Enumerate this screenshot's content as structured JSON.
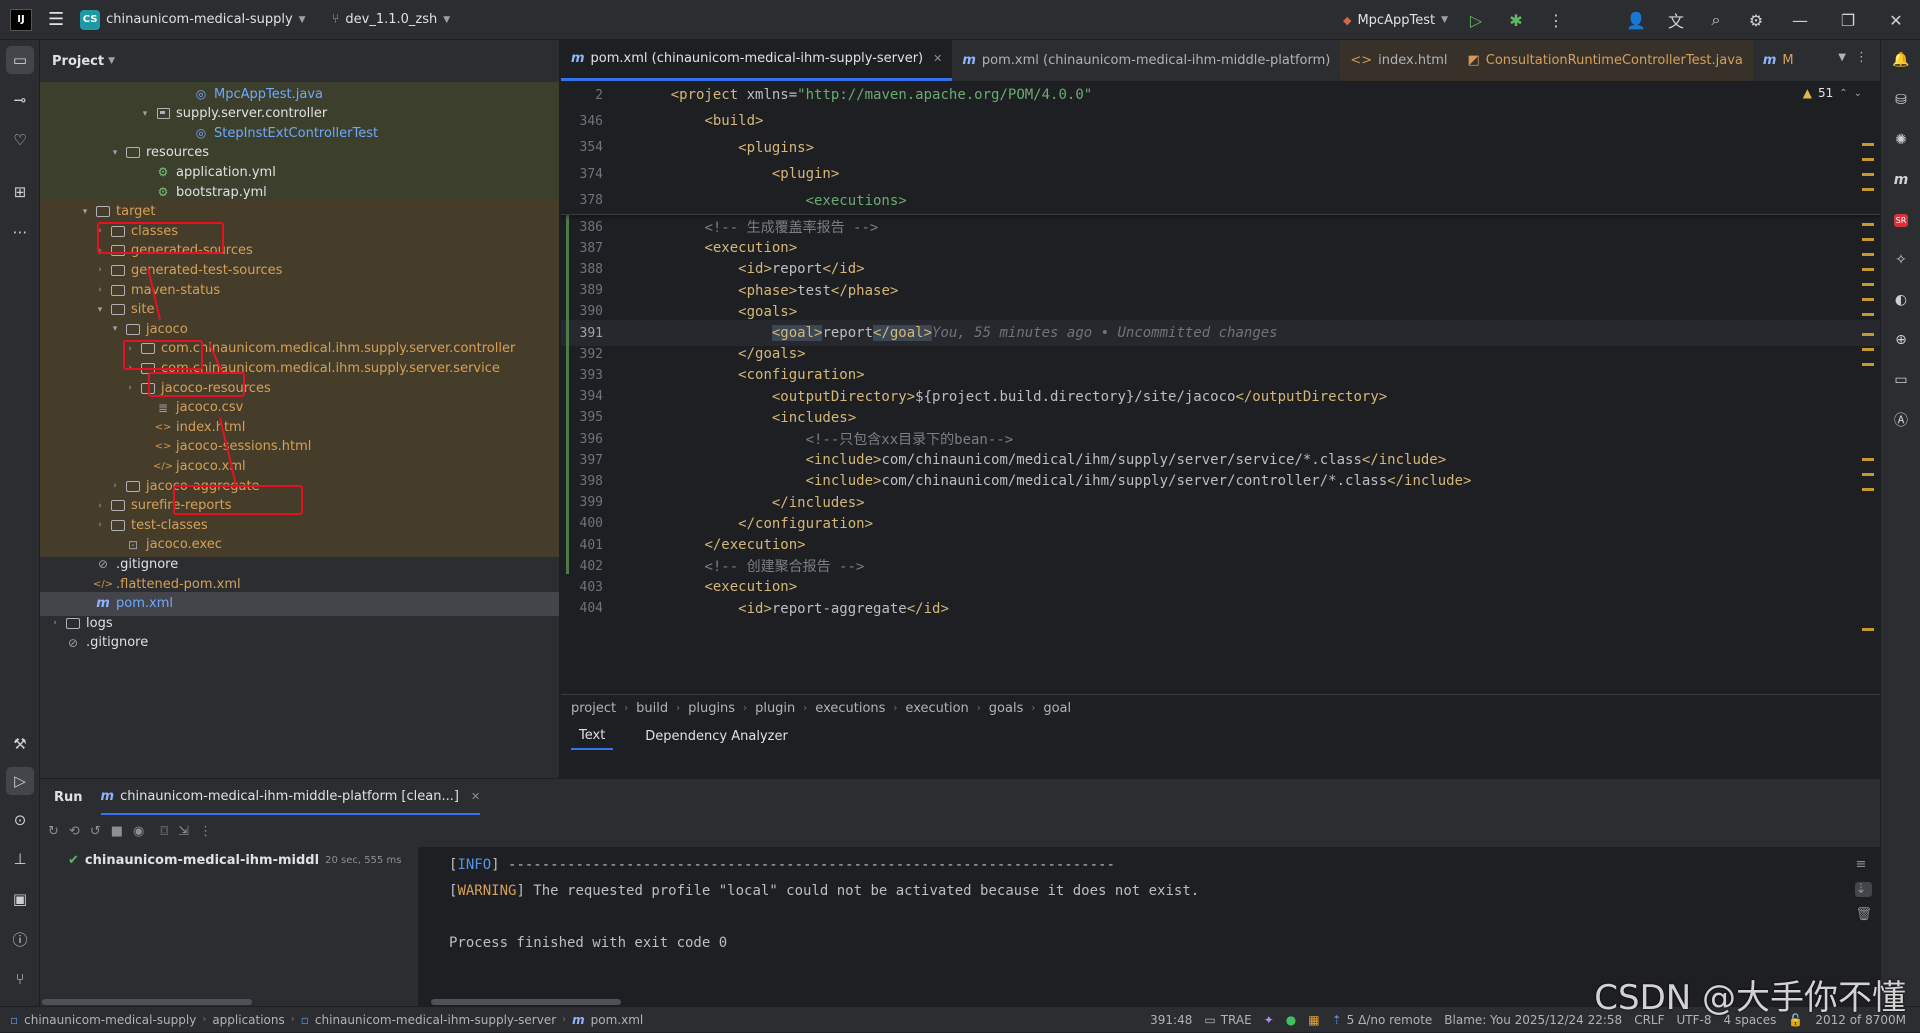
{
  "titlebar": {
    "app_logo": "IJ",
    "menu_icon": "hamburger-menu-icon",
    "project_badge": "CS",
    "project_name": "chinaunicom-medical-supply",
    "branch": "dev_1.1.0_zsh",
    "run_config": "MpcAppTest"
  },
  "project_panel": {
    "title": "Project",
    "rows": [
      {
        "label": "MpcAppTest.java",
        "type": "java"
      },
      {
        "label": "supply.server.controller",
        "type": "package"
      },
      {
        "label": "StepInstExtControllerTest",
        "type": "java"
      },
      {
        "label": "resources",
        "type": "folder"
      },
      {
        "label": "application.yml",
        "type": "yml"
      },
      {
        "label": "bootstrap.yml",
        "type": "yml"
      },
      {
        "label": "target",
        "type": "folder"
      },
      {
        "label": "classes",
        "type": "folder"
      },
      {
        "label": "generated-sources",
        "type": "folder"
      },
      {
        "label": "generated-test-sources",
        "type": "folder"
      },
      {
        "label": "maven-status",
        "type": "folder"
      },
      {
        "label": "site",
        "type": "folder"
      },
      {
        "label": "jacoco",
        "type": "folder"
      },
      {
        "label": "com.chinaunicom.medical.ihm.supply.server.controller",
        "type": "folder"
      },
      {
        "label": "com.chinaunicom.medical.ihm.supply.server.service",
        "type": "folder"
      },
      {
        "label": "jacoco-resources",
        "type": "folder"
      },
      {
        "label": "jacoco.csv",
        "type": "csv"
      },
      {
        "label": "index.html",
        "type": "html"
      },
      {
        "label": "jacoco-sessions.html",
        "type": "html"
      },
      {
        "label": "jacoco.xml",
        "type": "xml"
      },
      {
        "label": "jacoco-aggregate",
        "type": "folder"
      },
      {
        "label": "surefire-reports",
        "type": "folder"
      },
      {
        "label": "test-classes",
        "type": "folder"
      },
      {
        "label": "jacoco.exec",
        "type": "exec"
      },
      {
        "label": ".gitignore",
        "type": "ignore"
      },
      {
        "label": ".flattened-pom.xml",
        "type": "xml"
      },
      {
        "label": "pom.xml",
        "type": "pom"
      },
      {
        "label": "logs",
        "type": "folder"
      },
      {
        "label": ".gitignore",
        "type": "ignore"
      }
    ]
  },
  "editor": {
    "tabs": [
      {
        "label": "pom.xml (chinaunicom-medical-ihm-supply-server)",
        "icon": "m"
      },
      {
        "label": "pom.xml (chinaunicom-medical-ihm-middle-platform)",
        "icon": "m"
      },
      {
        "label": "index.html",
        "icon": "<>"
      },
      {
        "label": "ConsultationRuntimeControllerTest.java",
        "icon": "j"
      },
      {
        "label": "M",
        "icon": "m"
      }
    ],
    "warning_count": "51",
    "sticky": [
      {
        "num": "2",
        "text": "<project xmlns=\"http://maven.apache.org/POM/4.0.0\""
      },
      {
        "num": "346",
        "text": "<build>"
      },
      {
        "num": "354",
        "text": "<plugins>"
      },
      {
        "num": "374",
        "text": "<plugin>"
      },
      {
        "num": "378",
        "text": "<executions>"
      }
    ],
    "lines": [
      {
        "num": "386",
        "text": "<!-- 生成覆盖率报告 -->"
      },
      {
        "num": "387",
        "text": "<execution>"
      },
      {
        "num": "388",
        "open": "<id>",
        "val": "report",
        "close": "</id>"
      },
      {
        "num": "389",
        "open": "<phase>",
        "val": "test",
        "close": "</phase>"
      },
      {
        "num": "390",
        "text": "<goals>"
      },
      {
        "num": "391",
        "open": "<goal>",
        "val": "report",
        "close": "</goal>",
        "ghost": "You, 55 minutes ago • Uncommitted changes"
      },
      {
        "num": "392",
        "text": "</goals>"
      },
      {
        "num": "393",
        "text": "<configuration>"
      },
      {
        "num": "394",
        "open": "<outputDirectory>",
        "val": "${project.build.directory}/site/jacoco",
        "close": "</outputDirectory>"
      },
      {
        "num": "395",
        "text": "<includes>"
      },
      {
        "num": "396",
        "text": "<!--只包含xx目录下的bean-->"
      },
      {
        "num": "397",
        "open": "<include>",
        "val": "com/chinaunicom/medical/ihm/supply/server/service/*.class",
        "close": "</include>"
      },
      {
        "num": "398",
        "open": "<include>",
        "val": "com/chinaunicom/medical/ihm/supply/server/controller/*.class",
        "close": "</include>"
      },
      {
        "num": "399",
        "text": "</includes>"
      },
      {
        "num": "400",
        "text": "</configuration>"
      },
      {
        "num": "401",
        "text": "</execution>"
      },
      {
        "num": "402",
        "text": "<!-- 创建聚合报告 -->"
      },
      {
        "num": "403",
        "text": "<execution>"
      },
      {
        "num": "404",
        "open": "<id>",
        "val": "report-aggregate",
        "close": "</id>"
      }
    ],
    "breadcrumb": [
      "project",
      "build",
      "plugins",
      "plugin",
      "executions",
      "execution",
      "goals",
      "goal"
    ],
    "mode_tabs": [
      "Text",
      "Dependency Analyzer"
    ]
  },
  "run_panel": {
    "title": "Run",
    "tab": "chinaunicom-medical-ihm-middle-platform [clean...]",
    "tree_item": "chinaunicom-medical-ihm-middl",
    "tree_time": "20 sec, 555 ms",
    "console": {
      "line1_tag": "INFO",
      "line1_rest": "] ------------------------------------------------------------------------",
      "line2_tag": "WARNING",
      "line2_rest": "] The requested profile \"local\" could not be activated because it does not exist.",
      "line3": "Process finished with exit code 0"
    }
  },
  "statusbar": {
    "path": [
      "chinaunicom-medical-supply",
      "applications",
      "chinaunicom-medical-ihm-supply-server",
      "pom.xml"
    ],
    "position": "391:48",
    "trae": "TRAE",
    "vcs": "5 Δ/no remote",
    "blame": "Blame: You 2025/12/24 22:58",
    "line_sep": "CRLF",
    "encoding": "UTF-8",
    "indent": "4 spaces",
    "memory": "2012 of 8700M"
  },
  "watermark": "CSDN @大手你不懂",
  "colors": {
    "accent": "#3574f0",
    "highlight_box": "#e81123",
    "tag": "#d5b778",
    "string": "#6aab73",
    "comment": "#7a7e85"
  }
}
